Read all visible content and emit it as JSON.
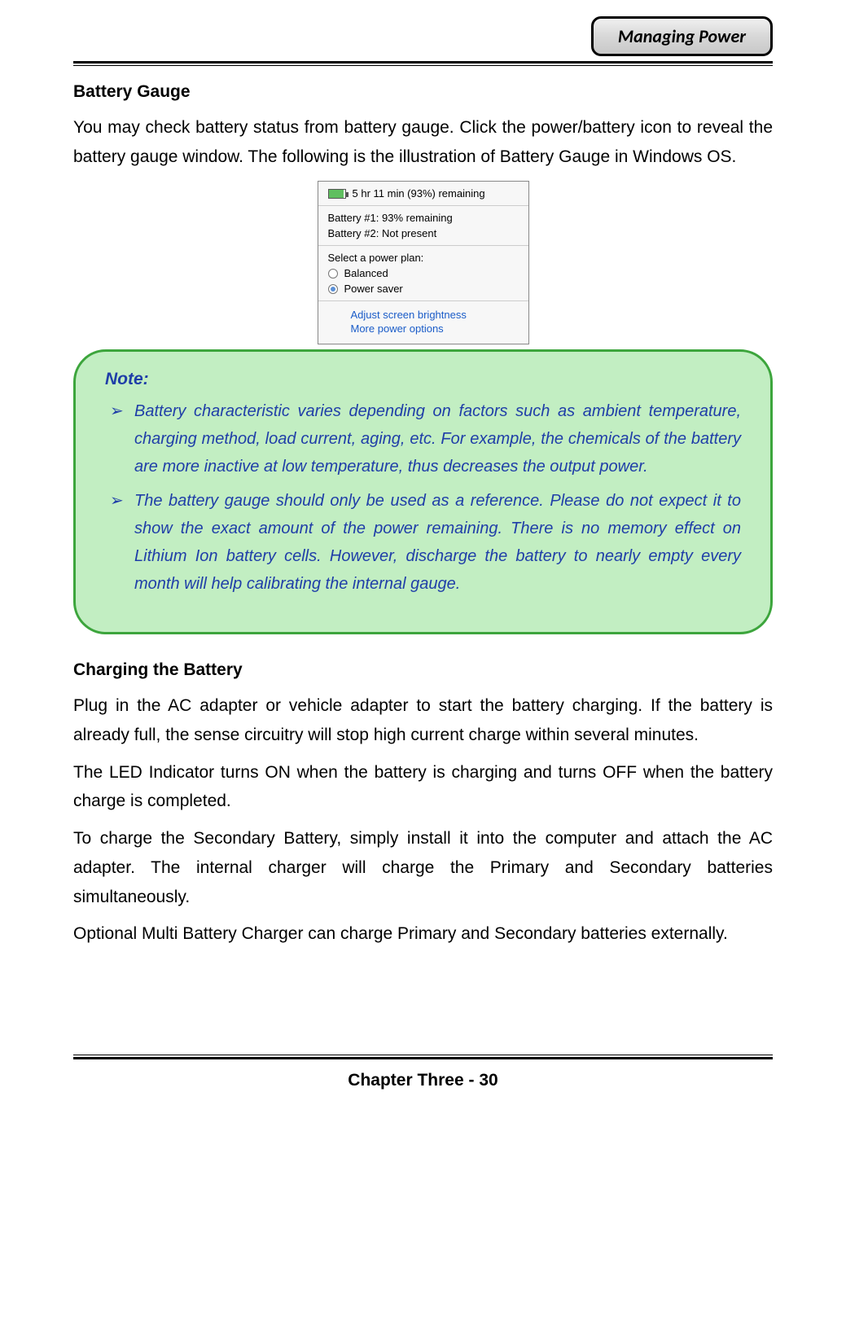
{
  "header": {
    "tab": "Managing Power"
  },
  "section1": {
    "heading": "Battery Gauge",
    "para": "You may check battery status from battery gauge. Click the power/battery icon to reveal the battery gauge window. The following is the illustration of Battery Gauge in Windows OS."
  },
  "gauge": {
    "remaining": "5 hr 11 min (93%) remaining",
    "b1": "Battery #1: 93% remaining",
    "b2": "Battery #2: Not present",
    "plan_label": "Select a power plan:",
    "plan1": "Balanced",
    "plan2": "Power saver",
    "link1": "Adjust screen brightness",
    "link2": "More power options"
  },
  "note": {
    "title": "Note:",
    "item1": "Battery characteristic varies depending on factors such as ambient temperature, charging method, load current, aging, etc. For example, the chemicals of the battery are more inactive at low temperature, thus decreases the output power.",
    "item2": "The battery gauge should only be used as a reference. Please do not expect it to show the exact amount of the power remaining. There is no memory effect on Lithium Ion battery cells. However, discharge the battery to nearly empty every month will help calibrating the internal gauge."
  },
  "section2": {
    "heading": "Charging the Battery",
    "p1": "Plug in the AC adapter or vehicle adapter to start the battery charging. If the battery is already full, the sense circuitry will stop high current charge within several minutes.",
    "p2": "The LED Indicator turns ON when the battery is charging and turns OFF when the battery charge is completed.",
    "p3": "To charge the Secondary Battery, simply install it into the computer and attach the AC adapter. The internal charger will charge the Primary and Secondary batteries simultaneously.",
    "p4": "Optional Multi Battery Charger can charge Primary and Secondary batteries externally."
  },
  "footer": "Chapter Three - 30"
}
